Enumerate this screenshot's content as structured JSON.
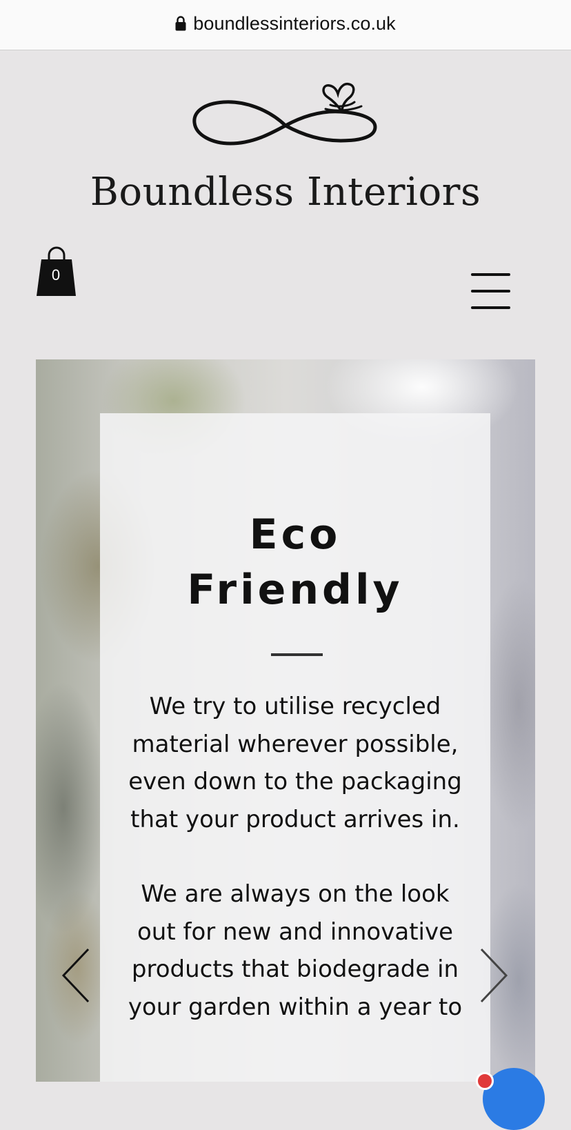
{
  "browser": {
    "url": "boundlessinteriors.co.uk",
    "lock_icon": "lock-icon"
  },
  "header": {
    "logo_icon": "infinity-heart-icon",
    "brand_name": "Boundless Interiors",
    "cart_icon": "shopping-bag-icon",
    "cart_count": "0",
    "menu_icon": "hamburger-menu-icon"
  },
  "slide": {
    "title_line1": "Eco",
    "title_line2": "Friendly",
    "paragraph1": "We try to utilise recycled material wherever possible, even down to the packaging that your product arrives in.",
    "paragraph2": "We are always on the look out for new and innovative products that biodegrade in your garden within a year to",
    "prev_icon": "chevron-left-icon",
    "next_icon": "chevron-right-icon"
  },
  "chat": {
    "icon": "chat-bubble-icon"
  },
  "colors": {
    "page_background": "#e7e5e6",
    "text": "#111111",
    "chat_blue": "#2b7be4",
    "badge_red": "#e03a3a"
  }
}
